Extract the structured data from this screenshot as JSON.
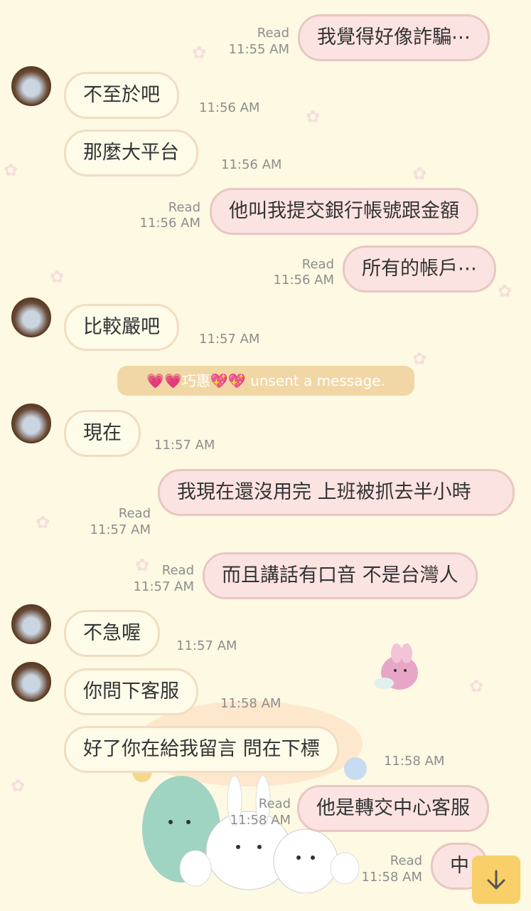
{
  "messages": [
    {
      "dir": "out",
      "text": "我覺得好像詐騙⋯",
      "read": "Read",
      "time": "11:55 AM"
    },
    {
      "dir": "in",
      "text": "不至於吧",
      "time": "11:56 AM"
    },
    {
      "dir": "in",
      "text": "那麼大平台",
      "time": "11:56 AM"
    },
    {
      "dir": "out",
      "text": "他叫我提交銀行帳號跟金額",
      "read": "Read",
      "time": "11:56 AM"
    },
    {
      "dir": "out",
      "text": "所有的帳戶⋯",
      "read": "Read",
      "time": "11:56 AM"
    },
    {
      "dir": "in",
      "text": "比較嚴吧",
      "time": "11:57 AM"
    },
    {
      "dir": "in",
      "text": "現在",
      "time": "11:57 AM"
    },
    {
      "dir": "out",
      "text": "我現在還沒用完 上班被抓去半小時",
      "read": "Read",
      "time": "11:57 AM"
    },
    {
      "dir": "out",
      "text": "而且講話有口音 不是台灣人",
      "read": "Read",
      "time": "11:57 AM"
    },
    {
      "dir": "in",
      "text": "不急喔",
      "time": "11:57 AM"
    },
    {
      "dir": "in",
      "text": "你問下客服",
      "time": "11:58 AM"
    },
    {
      "dir": "in",
      "text": "好了你在給我留言 問在下標",
      "time": "11:58 AM"
    },
    {
      "dir": "out",
      "text": "他是轉交中心客服",
      "read": "Read",
      "time": "11:58 AM"
    },
    {
      "dir": "out",
      "text": "中",
      "read": "Read",
      "time": "11:58 AM"
    }
  ],
  "system_notice": {
    "text": "💗💗巧惠💖💖 unsent a message."
  },
  "icons": {
    "scroll_down": "arrow-down-icon",
    "avatar": "contact-avatar"
  },
  "colors": {
    "background": "#fdf9e3",
    "incoming_bubble": "#fffbe9",
    "outgoing_bubble": "#fbe3e1",
    "scroll_button": "#f8cf68"
  }
}
